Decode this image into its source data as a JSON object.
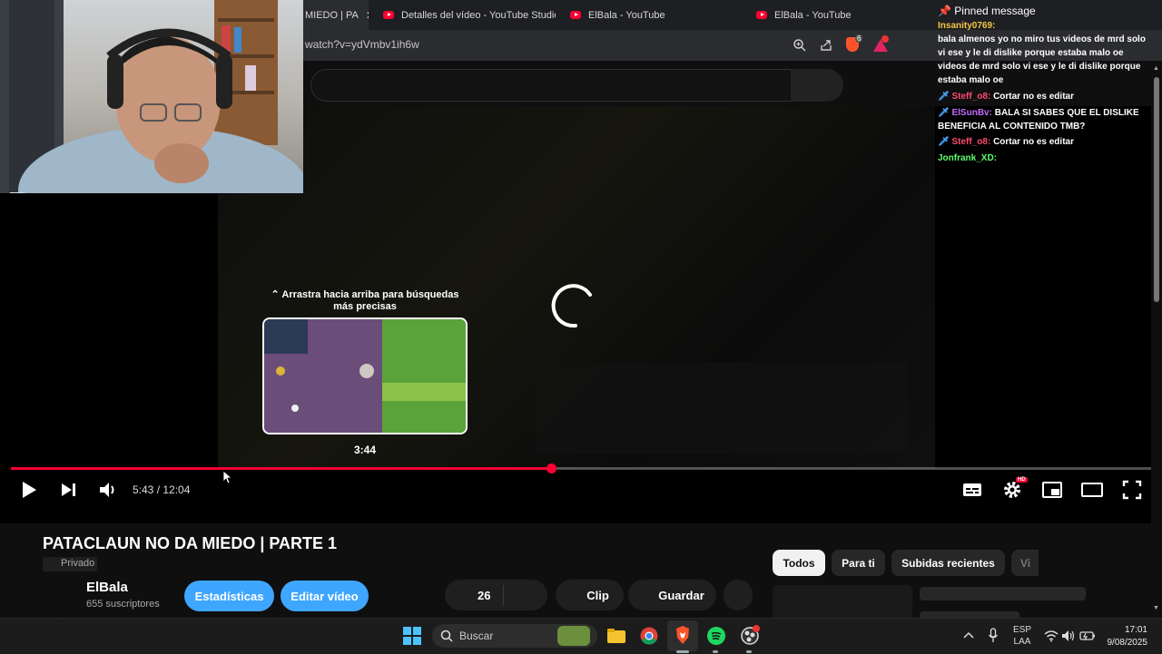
{
  "browser": {
    "tabs": [
      {
        "label": "MIEDO | PA",
        "active": true
      },
      {
        "label": "Detalles del vídeo - YouTube Studio",
        "active": false
      },
      {
        "label": "ElBala - YouTube",
        "active": false
      },
      {
        "label": "ElBala - YouTube",
        "active": false
      }
    ],
    "url": "watch?v=ydVmbv1ih6w",
    "brave_badge": "6"
  },
  "chat": {
    "pinned_label": "Pinned message",
    "messages": [
      {
        "user": "Insanity0769",
        "text": "bala almenos yo no miro tus videos de mrd solo vi ese y le di dislike porque estaba malo oe videos de mrd solo vi ese y le di dislike porque estaba malo oe"
      },
      {
        "user": "Steff_o8",
        "text": "Cortar no es editar"
      },
      {
        "user": "ElSunBv",
        "text": "BALA SI SABES QUE EL DISLIKE BENEFICIA AL CONTENIDO TMB?"
      },
      {
        "user": "Steff_o8",
        "text": "Cortar no es editar"
      },
      {
        "user": "Jonfrank_XD",
        "text": ""
      }
    ],
    "colors": {
      "Insanity0769": "#f5c542",
      "Steff_o8": "#ff4b6e",
      "ElSunBv": "#c46bff",
      "Jonfrank_XD": "#5dff6a"
    }
  },
  "player": {
    "seek_hint": "Arrastra hacia arriba para búsquedas más precisas",
    "preview_time": "3:44",
    "time_display": "5:43 / 12:04",
    "progress_fraction": 0.474,
    "hd_badge": "HD"
  },
  "video": {
    "title": "PATACLAUN NO DA MIEDO | PARTE 1",
    "privacy": "Privado",
    "channel": "ElBala",
    "subscribers": "655 suscriptores",
    "stats_button": "Estadísticas",
    "edit_button": "Editar vídeo",
    "likes": "26",
    "clip_button": "Clip",
    "save_button": "Guardar"
  },
  "chips": [
    "Todos",
    "Para ti",
    "Subidas recientes",
    "Vi"
  ],
  "taskbar": {
    "search_placeholder": "Buscar",
    "lang_top": "ESP",
    "lang_bottom": "LAA",
    "time": "17:01",
    "date": "9/08/2025"
  },
  "accent": "#ff0033",
  "button_blue": "#3ea6ff"
}
